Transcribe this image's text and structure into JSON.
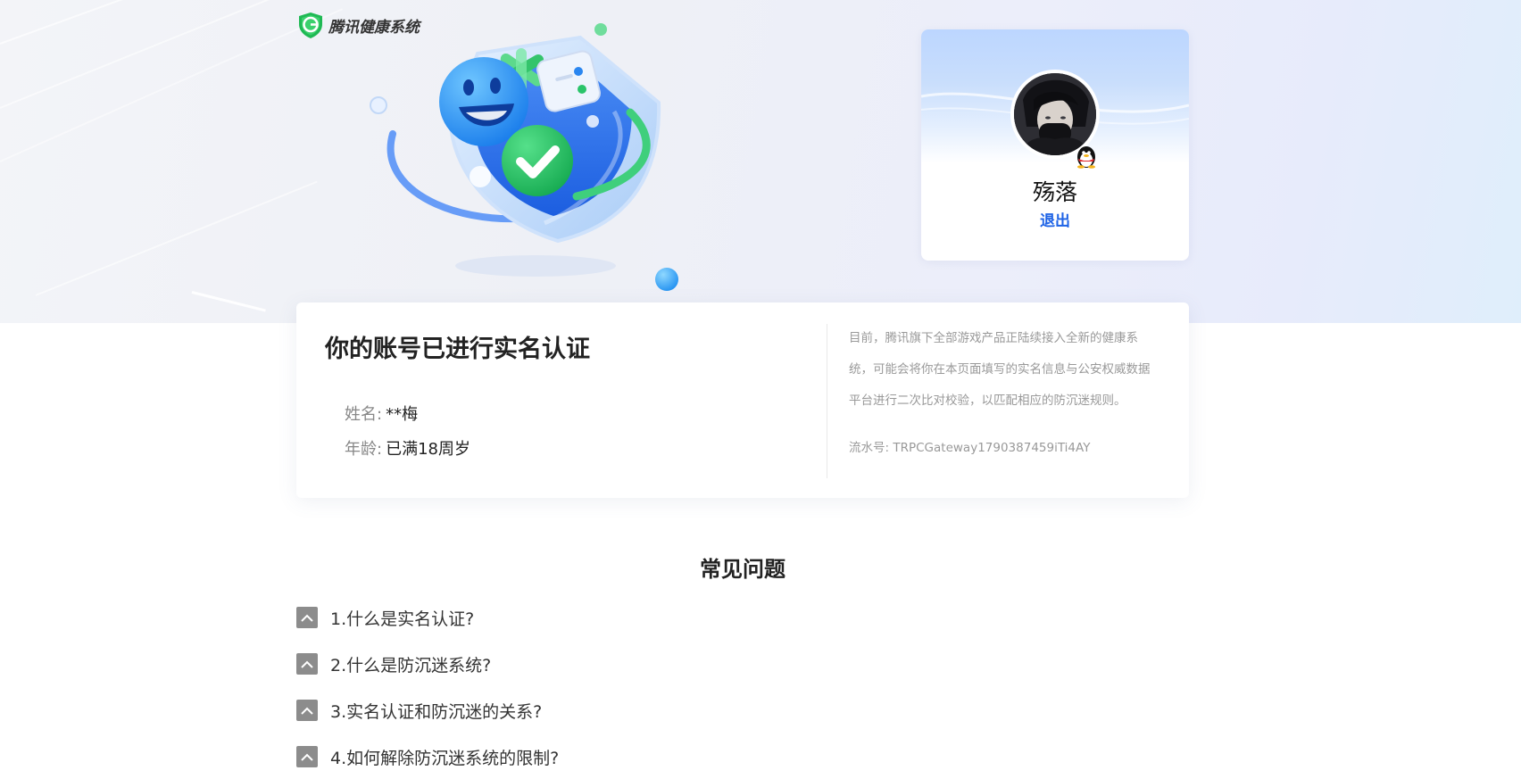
{
  "brand": {
    "name": "腾讯健康系统"
  },
  "profile": {
    "username": "殇落",
    "logout_label": "退出"
  },
  "verification": {
    "title": "你的账号已进行实名认证",
    "fields": [
      {
        "label": "姓名:",
        "value": "**梅"
      },
      {
        "label": "年龄:",
        "value": "已满18周岁"
      }
    ],
    "notice": "目前，腾讯旗下全部游戏产品正陆续接入全新的健康系统，可能会将你在本页面填写的实名信息与公安权威数据平台进行二次比对校验，以匹配相应的防沉迷规则。",
    "serial_label": "流水号:",
    "serial_value": "TRPCGateway1790387459iTi4AY"
  },
  "faq": {
    "title": "常见问题",
    "items": [
      {
        "question": "1.什么是实名认证?"
      },
      {
        "question": "2.什么是防沉迷系统?"
      },
      {
        "question": "3.实名认证和防沉迷的关系?"
      },
      {
        "question": "4.如何解除防沉迷系统的限制?"
      }
    ]
  },
  "colors": {
    "accent_link": "#1e63e6",
    "brand_green": "#1fb954",
    "faq_toggle": "#8c8c8c"
  },
  "icons": [
    "shield-logo-icon",
    "qq-penguin-icon",
    "chevron-up-icon"
  ]
}
